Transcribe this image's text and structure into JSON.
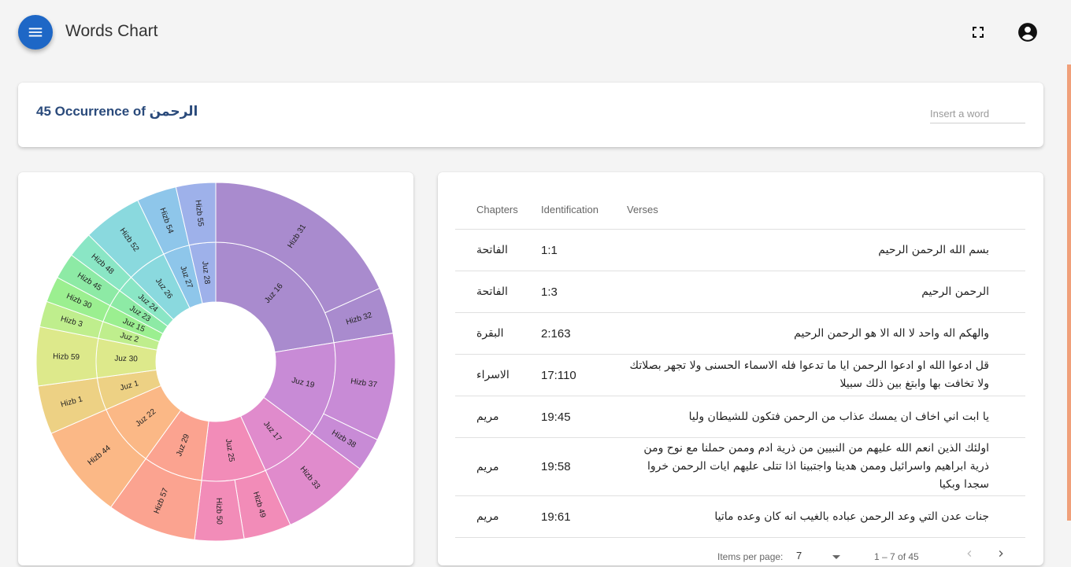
{
  "app": {
    "title": "Words Chart"
  },
  "search": {
    "count": "45",
    "occurrence_label": "Occurrence of",
    "word": "الرحمن",
    "placeholder": "Insert a word"
  },
  "table": {
    "headers": {
      "chapters": "Chapters",
      "identification": "Identification",
      "verses": "Verses"
    },
    "rows": [
      {
        "chapter": "الفاتحة",
        "id": "1:1",
        "verse": "بسم الله الرحمن الرحيم"
      },
      {
        "chapter": "الفاتحة",
        "id": "1:3",
        "verse": "الرحمن الرحيم"
      },
      {
        "chapter": "البقرة",
        "id": "2:163",
        "verse": "والهكم اله واحد لا اله الا هو الرحمن الرحيم"
      },
      {
        "chapter": "الاسراء",
        "id": "17:110",
        "verse": "قل ادعوا الله او ادعوا الرحمن ايا ما تدعوا فله الاسماء الحسنى ولا تجهر بصلاتك ولا تخافت بها وابتغ بين ذلك سبيلا"
      },
      {
        "chapter": "مريم",
        "id": "19:45",
        "verse": "يا ابت اني اخاف ان يمسك عذاب من الرحمن فتكون للشيطان وليا"
      },
      {
        "chapter": "مريم",
        "id": "19:58",
        "verse": "اولئك الذين انعم الله عليهم من النبيين من ذرية ادم وممن حملنا مع نوح ومن ذرية ابراهيم واسرائيل وممن هدينا واجتبينا اذا تتلى عليهم ايات الرحمن خروا سجدا وبكيا"
      },
      {
        "chapter": "مريم",
        "id": "19:61",
        "verse": "جنات عدن التي وعد الرحمن عباده بالغيب انه كان وعده ماتيا"
      }
    ]
  },
  "paginator": {
    "items_per_page_label": "Items per page:",
    "page_size": "7",
    "range": "1 – 7 of 45"
  },
  "icons": {
    "menu": "menu-icon",
    "fullscreen": "fullscreen-icon",
    "account": "account-circle-icon",
    "prev": "chevron-left-icon",
    "next": "chevron-right-icon"
  },
  "colors": {
    "accent": "#1e67c6",
    "title_text": "#2a4a7b"
  },
  "chart_data": {
    "type": "sunburst",
    "rings": {
      "inner": [
        {
          "label": "Juz 16",
          "start": 0,
          "end": 0.2245,
          "color": "#a98bce"
        },
        {
          "label": "Juz 19",
          "start": 0.2245,
          "end": 0.3518,
          "color": "#c88bd6"
        },
        {
          "label": "Juz 17",
          "start": 0.3518,
          "end": 0.4318,
          "color": "#e08bcc"
        },
        {
          "label": "Juz 25",
          "start": 0.4318,
          "end": 0.5189,
          "color": "#f28cb8"
        },
        {
          "label": "Juz 29",
          "start": 0.5189,
          "end": 0.5994,
          "color": "#fba390"
        },
        {
          "label": "Juz 22",
          "start": 0.5994,
          "end": 0.6845,
          "color": "#fbb886"
        },
        {
          "label": "Juz 1",
          "start": 0.6845,
          "end": 0.7283,
          "color": "#edd184"
        },
        {
          "label": "Juz 30",
          "start": 0.7283,
          "end": 0.7814,
          "color": "#dde98b"
        },
        {
          "label": "Juz 2",
          "start": 0.7814,
          "end": 0.8046,
          "color": "#bfee8d"
        },
        {
          "label": "Juz 15",
          "start": 0.8046,
          "end": 0.8279,
          "color": "#9bef90"
        },
        {
          "label": "Juz 23",
          "start": 0.8279,
          "end": 0.8514,
          "color": "#8deaa5"
        },
        {
          "label": "Juz 24",
          "start": 0.8514,
          "end": 0.8749,
          "color": "#8ae6c5"
        },
        {
          "label": "Juz 26",
          "start": 0.8749,
          "end": 0.9284,
          "color": "#8ad9de"
        },
        {
          "label": "Juz 27",
          "start": 0.9284,
          "end": 0.9643,
          "color": "#8ec6ea"
        },
        {
          "label": "Juz 28",
          "start": 0.9643,
          "end": 1.0,
          "color": "#9eb1ea"
        }
      ],
      "outer": [
        {
          "label": "Hizb 31",
          "start": 0,
          "end": 0.1829,
          "color": "#a98bce"
        },
        {
          "label": "Hizb 32",
          "start": 0.1829,
          "end": 0.2245,
          "color": "#a98bce"
        },
        {
          "label": "Hizb 37",
          "start": 0.2245,
          "end": 0.3217,
          "color": "#c88bd6"
        },
        {
          "label": "Hizb 38",
          "start": 0.3217,
          "end": 0.3518,
          "color": "#c88bd6"
        },
        {
          "label": "Hizb 33",
          "start": 0.3518,
          "end": 0.4318,
          "color": "#e08bcc"
        },
        {
          "label": "Hizb 49",
          "start": 0.4318,
          "end": 0.4747,
          "color": "#f28cb8"
        },
        {
          "label": "Hizb 50",
          "start": 0.4747,
          "end": 0.5189,
          "color": "#f28cb8"
        },
        {
          "label": "Hizb 57",
          "start": 0.5189,
          "end": 0.5994,
          "color": "#fba390"
        },
        {
          "label": "Hizb 44",
          "start": 0.5994,
          "end": 0.6845,
          "color": "#fbb886"
        },
        {
          "label": "Hizb 1",
          "start": 0.6845,
          "end": 0.7283,
          "color": "#edd184"
        },
        {
          "label": "Hizb 59",
          "start": 0.7283,
          "end": 0.7814,
          "color": "#dde98b"
        },
        {
          "label": "Hizb 3",
          "start": 0.7814,
          "end": 0.8046,
          "color": "#bfee8d"
        },
        {
          "label": "Hizb 30",
          "start": 0.8046,
          "end": 0.8279,
          "color": "#9bef90"
        },
        {
          "label": "Hizb 45",
          "start": 0.8279,
          "end": 0.8514,
          "color": "#8deaa5"
        },
        {
          "label": "Hizb 48",
          "start": 0.8514,
          "end": 0.8749,
          "color": "#8ae6c5"
        },
        {
          "label": "Hizb 52",
          "start": 0.8749,
          "end": 0.9284,
          "color": "#8ad9de"
        },
        {
          "label": "Hizb 54",
          "start": 0.9284,
          "end": 0.9643,
          "color": "#8ec6ea"
        },
        {
          "label": "Hizb 55",
          "start": 0.9643,
          "end": 1.0,
          "color": "#9eb1ea"
        }
      ]
    }
  }
}
